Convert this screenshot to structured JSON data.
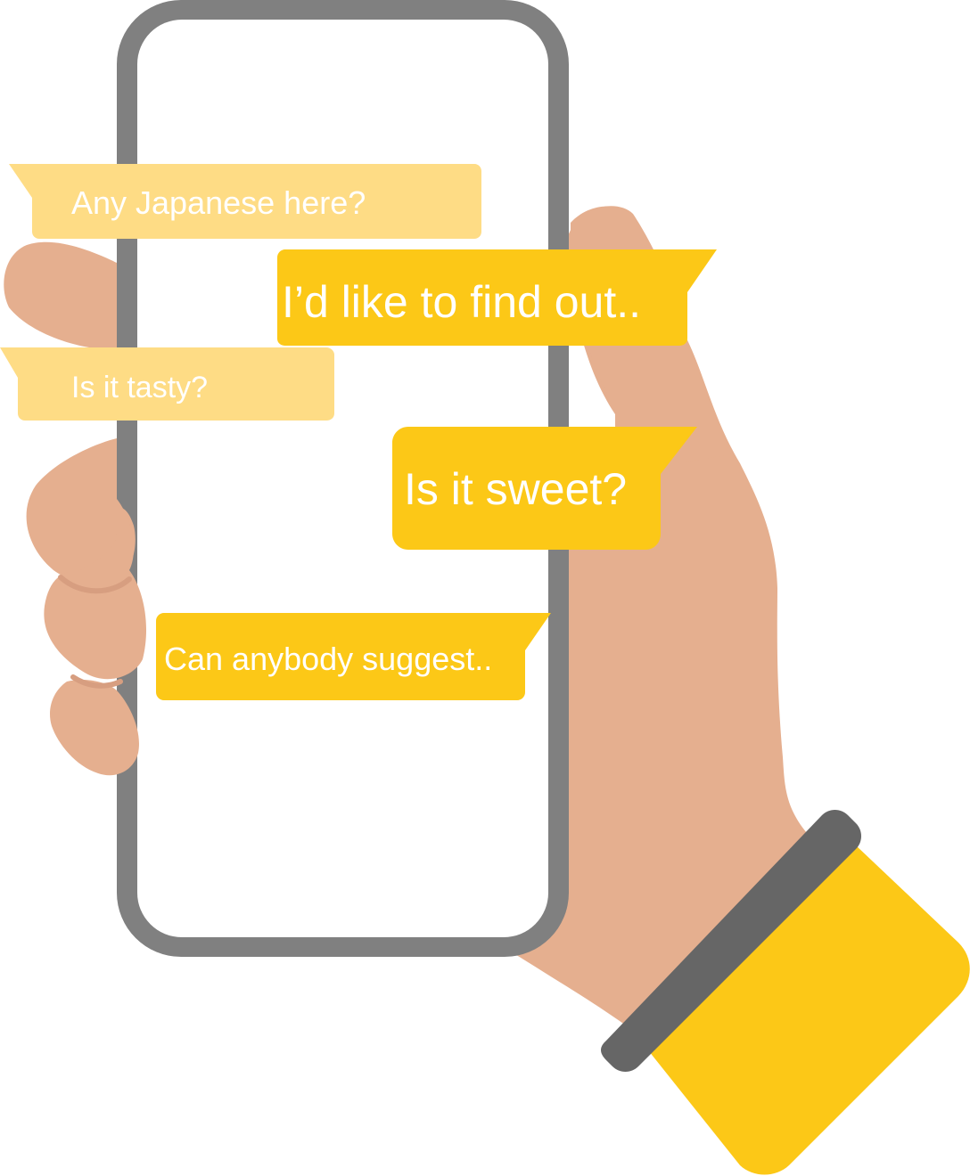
{
  "colors": {
    "skin": "#E5AF8F",
    "skin_shadow": "#D79E80",
    "phone_frame": "#808080",
    "phone_screen": "#FFFFFF",
    "bubble_light": "#FEDC85",
    "bubble_strong": "#FCC817",
    "sleeve": "#FCC817",
    "cuff_band": "#666666",
    "text": "#FFFFFF"
  },
  "messages": [
    {
      "id": "any-japanese",
      "text": "Any Japanese here?",
      "style": "light"
    },
    {
      "id": "find-out",
      "text": "I’d like to find out..",
      "style": "strong"
    },
    {
      "id": "tasty",
      "text": "Is it tasty?",
      "style": "light"
    },
    {
      "id": "sweet",
      "text": "Is it sweet?",
      "style": "strong"
    },
    {
      "id": "suggest",
      "text": "Can anybody suggest..",
      "style": "strong"
    }
  ]
}
